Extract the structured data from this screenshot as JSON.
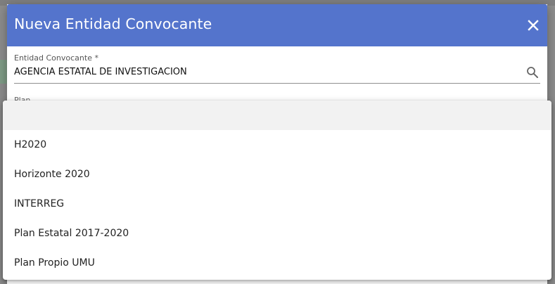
{
  "dialog": {
    "title": "Nueva Entidad Convocante",
    "close_icon": "close-icon"
  },
  "entidad_field": {
    "label": "Entidad Convocante *",
    "value": "AGENCIA ESTATAL DE INVESTIGACION",
    "search_icon": "search-icon"
  },
  "plan_field": {
    "label": "Plan"
  },
  "dropdown": {
    "options": [
      {
        "label": ""
      },
      {
        "label": "H2020"
      },
      {
        "label": "Horizonte 2020"
      },
      {
        "label": "INTERREG"
      },
      {
        "label": "Plan Estatal 2017-2020"
      },
      {
        "label": "Plan Propio UMU"
      }
    ]
  },
  "colors": {
    "header": "#5474cc",
    "selected_option": "#f2f2f2"
  }
}
